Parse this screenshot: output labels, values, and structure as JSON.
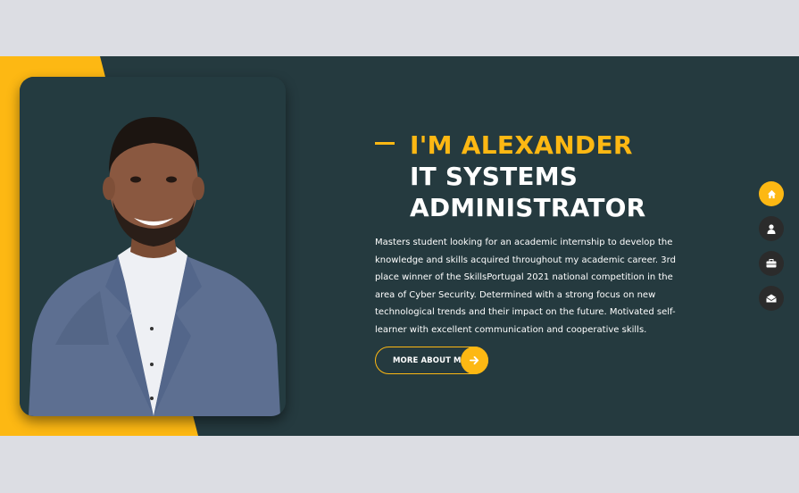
{
  "hero": {
    "greeting": "I'M ALEXANDER",
    "role_line1": "IT SYSTEMS",
    "role_line2": "ADMINISTRATOR",
    "description": "Masters student looking for an academic internship to develop the knowledge and skills acquired throughout my academic career. 3rd place winner of the SkillsPortugal 2021 national competition in the area of Cyber Security. Determined with a strong focus on new technological trends and their impact on the future. Motivated self-learner with excellent communication and cooperative skills.",
    "button_label": "MORE ABOUT ME"
  },
  "nav": {
    "items": [
      {
        "icon": "home-icon",
        "active": true
      },
      {
        "icon": "user-icon",
        "active": false
      },
      {
        "icon": "briefcase-icon",
        "active": false
      },
      {
        "icon": "envelope-icon",
        "active": false
      }
    ]
  },
  "colors": {
    "accent": "#fdb813",
    "background": "#253a3f",
    "page": "#dcdde3",
    "nav_inactive": "#2b2b2b"
  }
}
